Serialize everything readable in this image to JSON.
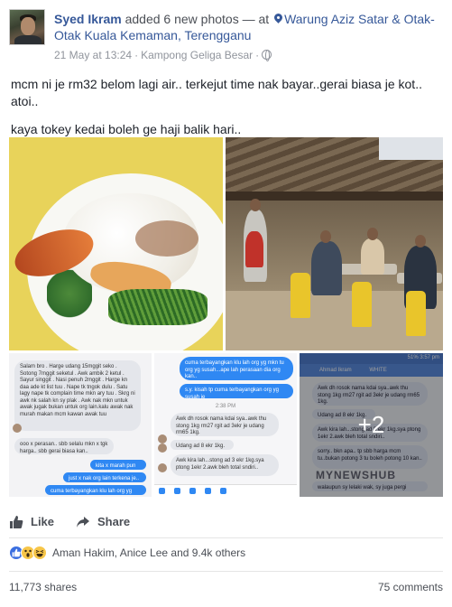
{
  "post": {
    "author": "Syed Ikram",
    "action": "added 6 new photos —",
    "at": "at",
    "place": "Warung Aziz Satar & Otak-Otak Kuala Kemaman, Terengganu",
    "date": "21 May at 13:24",
    "location": "Kampong Geliga Besar",
    "text_line1": "mcm ni je rm32 belom lagi air.. terkejut time nak bayar..gerai biasa je kot.. atoi..",
    "text_line2": "kaya tokey kedai boleh ge haji balik hari.."
  },
  "photos": {
    "more_count": "+2",
    "chat1": {
      "msg1": "Salam bro . Harge udang 15mggit seko . Sotong 7mggit seketul . Awk ambik 2 ketul . Sayur singgit . Nasi penuh 2mggit . Harge kn daa ade kt list tuu . Nape tk tngok dulu . Satu lagy nape tk complain time mkn ary tuu . Skrg ni awk nk salah kn sy plak . Awk nak mkn untuk awak jugak bukan untuk org lain.kalu awak nak murah makan mcm kawan awak tuu",
      "msg2": "ooo x perasan.. sbb selalu mkn x tgk harga.. sbb gerai biasa kan..",
      "msg3": "kita x marah pun",
      "msg4": "just x nak org lain terkena je..",
      "msg5": "cuma terbayangkan klu lah org yg mkn"
    },
    "chat2": {
      "msg1": "cuma terbayangkan klu lah org yg mkn tu org yg susah...ape lah perasaan dia org kan..",
      "msg2": "s.y. kisah tp cuma terbayangkan org yg susah je",
      "time": "2:38 PM",
      "msg3": "Awk dh rosok nama kdai sya..awk thu stong 1kg rm27 rgit ad 3ekr je udang rm65 1kg.",
      "msg4": "Udang ad 8 ekr 1kg.",
      "msg5": "Awk kira lah...stong ad 3 ekr 1kg.sya ptong 1ekr 2.awk bleh total sndiri.."
    },
    "chat3": {
      "status": "51% 3:57 pm",
      "contact": "Ahmad Ikram",
      "tag": "WHITE",
      "msg1": "Awk dh rosok nama kdai sya..awk thu stong 1kg rm27 rgit ad 3ekr je udang rm65 1kg.",
      "msg2": "Udang ad 8 ekr 1kg.",
      "msg3": "Awk kira lah...stong ad 3 ekr 1kg.sya ptong 1ekr 2.awk bleh total sndiri..",
      "msg4": "sorry.. bkn apa.. tp sbb harga mcm tu..bukan potong 3 tu boleh potong 10 kan..",
      "msg5": "walaupun sy lelaki wak, sy juga pergi",
      "watermark": "MYNEWSHUB"
    }
  },
  "actions": {
    "like": "Like",
    "share": "Share"
  },
  "reactions": {
    "names": "Aman Hakim, Anice Lee and 9.4k others"
  },
  "stats": {
    "shares": "11,773 shares",
    "comments": "75 comments"
  },
  "colors": {
    "link": "#365899",
    "like_blue": "#3b6fe0",
    "messenger_blue": "#2f88f3"
  }
}
